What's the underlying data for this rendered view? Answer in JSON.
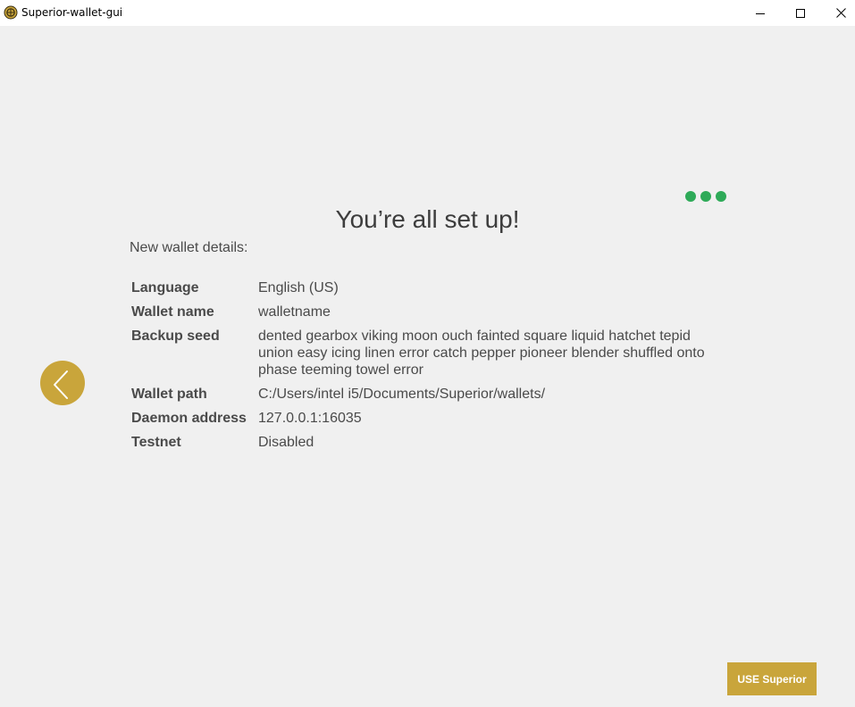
{
  "window": {
    "title": "Superior-wallet-gui",
    "icon": "superior-logo-icon",
    "controls": [
      "minimize-icon",
      "maximize-icon",
      "close-icon"
    ]
  },
  "colors": {
    "accent": "#c9a53b",
    "progress": "#2eaa58",
    "background": "#f0f0f0",
    "text": "#3d3d3d"
  },
  "progress": {
    "total_steps": 3,
    "completed_steps": 3
  },
  "page": {
    "heading": "You’re all set up!",
    "subheading": "New wallet details:"
  },
  "details": [
    {
      "label": "Language",
      "value": "English (US)"
    },
    {
      "label": "Wallet name",
      "value": "walletname"
    },
    {
      "label": "Backup seed",
      "value": "dented gearbox viking moon ouch fainted square liquid hatchet tepid union easy icing linen error catch pepper pioneer blender shuffled onto phase teeming towel error"
    },
    {
      "label": "Wallet path",
      "value": "C:/Users/intel i5/Documents/Superior/wallets/"
    },
    {
      "label": "Daemon address",
      "value": "127.0.0.1:16035"
    },
    {
      "label": "Testnet",
      "value": "Disabled"
    }
  ],
  "nav": {
    "back_icon": "chevron-left-icon"
  },
  "actions": {
    "use_label": "USE Superior"
  }
}
